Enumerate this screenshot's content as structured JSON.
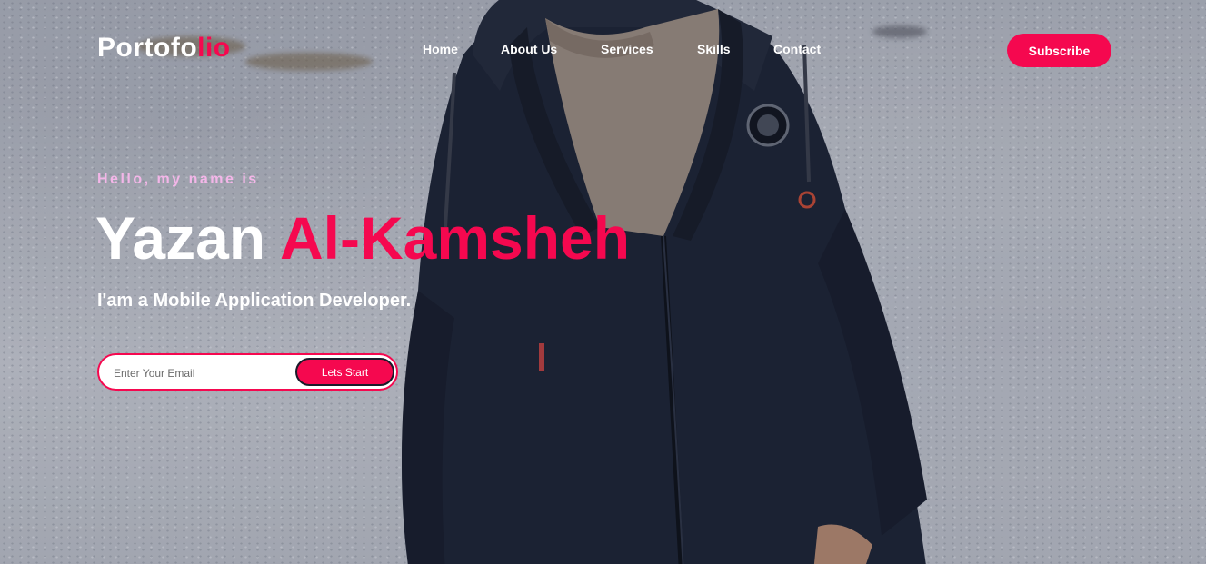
{
  "brand": {
    "logo_main": "Portofo",
    "logo_accent": "lio"
  },
  "nav": {
    "items": [
      {
        "label": "Home"
      },
      {
        "label": "About Us"
      },
      {
        "label": "Services"
      },
      {
        "label": "Skills"
      },
      {
        "label": "Contact"
      }
    ],
    "subscribe_label": "Subscribe"
  },
  "hero": {
    "greeting": "Hello, my name is",
    "first_name": "Yazan",
    "last_name": "Al-Kamsheh",
    "tagline": "I'am a Mobile Application Developer.",
    "email_placeholder": "Enter Your Email",
    "cta_label": "Lets Start",
    "background_image": "person-in-jacket-snow-photo"
  },
  "colors": {
    "accent": "#f5084f",
    "greeting": "#f3b6e8",
    "text": "#ffffff"
  }
}
